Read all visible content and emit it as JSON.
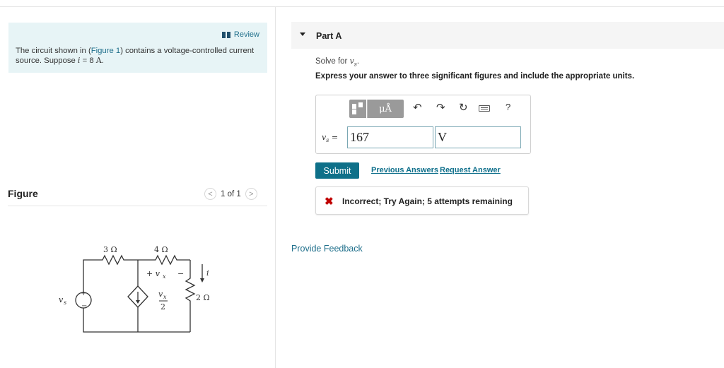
{
  "left": {
    "review_label": "Review",
    "intro": {
      "text_before": "The circuit shown in (",
      "figure_link": "Figure 1",
      "text_after": ") contains a voltage-controlled current source. Suppose ",
      "var": "i",
      "equals": " = 8 ",
      "unit": "A",
      "end": "."
    },
    "figure_title": "Figure",
    "pager": {
      "prev": "<",
      "label": "1 of 1",
      "next": ">"
    },
    "circuit": {
      "r1": "3 Ω",
      "r2": "4 Ω",
      "r3": "2 Ω",
      "vs": "v",
      "vs_sub": "s",
      "vx_label": "+ v",
      "vx_sub": "x",
      "vx_minus": "−",
      "source_num": "v",
      "source_num_sub": "x",
      "source_den": "2",
      "current": "i",
      "plus": "+",
      "minus": "−"
    }
  },
  "part": {
    "label": "Part A",
    "solve_prefix": "Solve for ",
    "solve_var": "v",
    "solve_sub": "s",
    "solve_end": ".",
    "express": "Express your answer to three significant figures and include the appropriate units."
  },
  "toolbar": {
    "units_label": "μÅ",
    "undo": "↶",
    "redo": "↷",
    "reset": "↻",
    "help": "?"
  },
  "answer": {
    "var_label": "v",
    "var_sub": "s",
    "equals": " =",
    "value": "167",
    "unit": "V"
  },
  "actions": {
    "submit": "Submit",
    "previous_answers": "Previous Answers",
    "request_answer": "Request Answer"
  },
  "feedback": {
    "icon": "✖",
    "text": "Incorrect; Try Again; 5 attempts remaining"
  },
  "provide_feedback": "Provide Feedback",
  "colors": {
    "accent": "#0e7089",
    "intro_bg": "#e7f4f6",
    "error": "#c00000"
  }
}
